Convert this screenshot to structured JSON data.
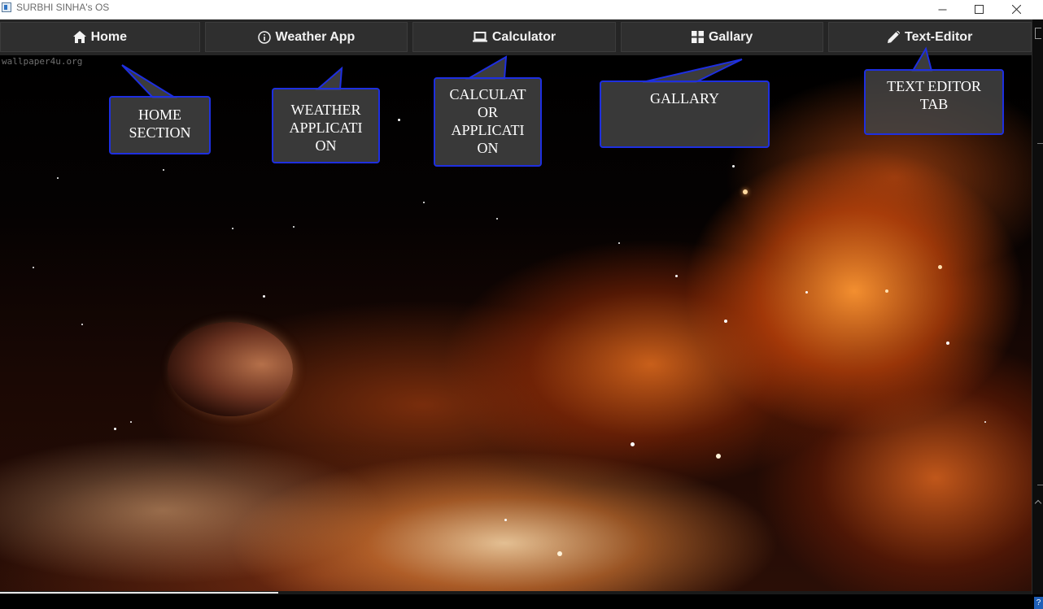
{
  "window": {
    "title": "SURBHI SINHA's OS",
    "controls": [
      "minimize",
      "maximize",
      "close"
    ]
  },
  "nav": {
    "tabs": [
      {
        "label": "Home",
        "icon": "home-icon"
      },
      {
        "label": "Weather App",
        "icon": "info-icon"
      },
      {
        "label": "Calculator",
        "icon": "laptop-icon"
      },
      {
        "label": "Gallary",
        "icon": "grid-icon"
      },
      {
        "label": "Text-Editor",
        "icon": "pencil-icon"
      }
    ]
  },
  "wallpaper": {
    "watermark": "wallpaper4u.org",
    "description_colors": {
      "cloud": "#e07a25",
      "space": "#000000"
    }
  },
  "callouts": {
    "home": "HOME\nSECTION",
    "weather": "WEATHER\nAPPLICATI\nON",
    "calculator": "CALCULAT\nOR\nAPPLICATI\nON",
    "gallery": "GALLARY",
    "text_editor": "TEXT EDITOR\nTAB"
  },
  "colors": {
    "callout_border": "#1e2fe0",
    "callout_fill": "#464646",
    "nav_bg": "#2f2f2f"
  }
}
